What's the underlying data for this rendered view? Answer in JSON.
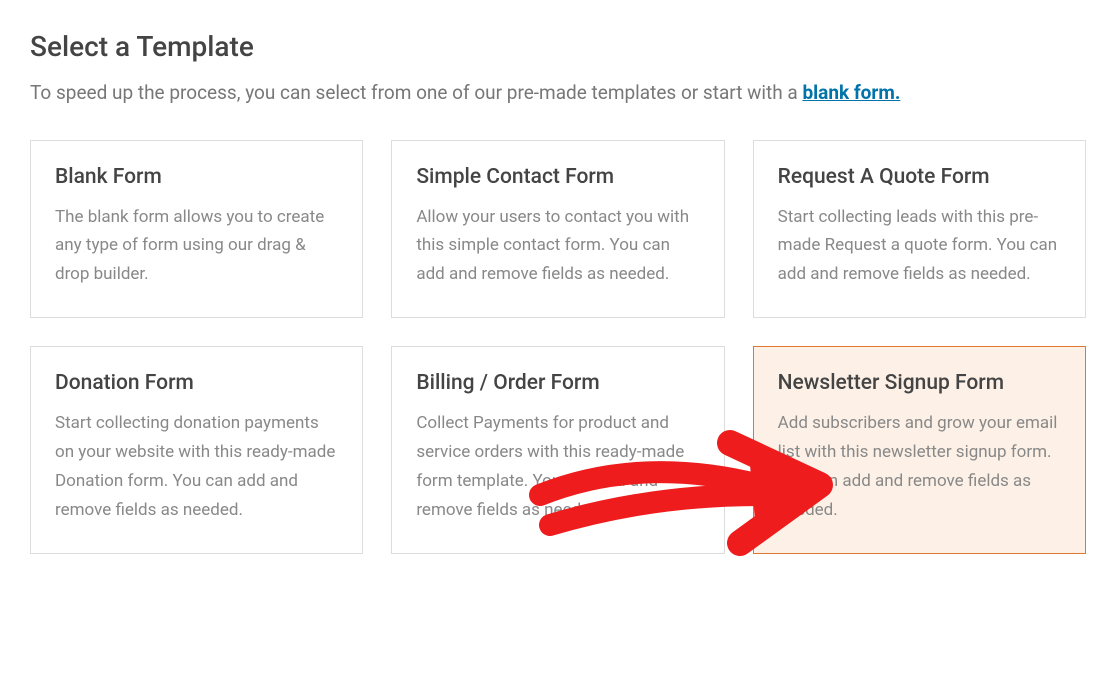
{
  "header": {
    "title": "Select a Template",
    "subtitle_pre": "To speed up the process, you can select from one of our pre-made templates or start with a ",
    "blank_link": "blank form."
  },
  "templates": [
    {
      "title": "Blank Form",
      "desc": "The blank form allows you to create any type of form using our drag & drop builder."
    },
    {
      "title": "Simple Contact Form",
      "desc": "Allow your users to contact you with this simple contact form. You can add and remove fields as needed."
    },
    {
      "title": "Request A Quote Form",
      "desc": "Start collecting leads with this pre-made Request a quote form. You can add and remove fields as needed."
    },
    {
      "title": "Donation Form",
      "desc": "Start collecting donation payments on your website with this ready-made Donation form. You can add and remove fields as needed."
    },
    {
      "title": "Billing / Order Form",
      "desc": "Collect Payments for product and service orders with this ready-made form template. You can add and remove fields as needed."
    },
    {
      "title": "Newsletter Signup Form",
      "desc": "Add subscribers and grow your email list with this newsletter signup form. You can add and remove fields as needed."
    }
  ]
}
